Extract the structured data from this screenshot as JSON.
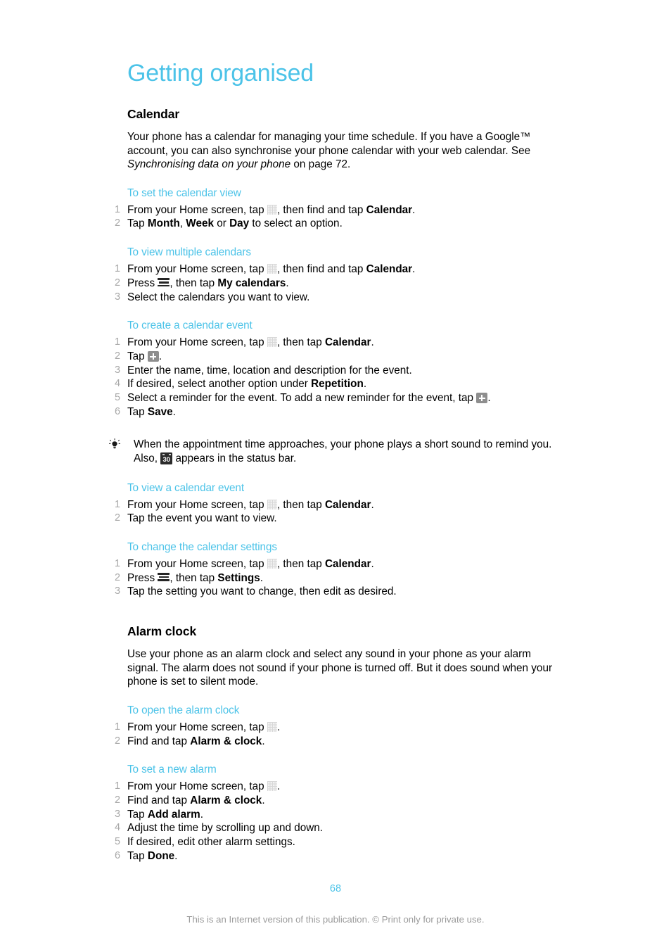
{
  "document": {
    "chapter_title": "Getting organised",
    "page_number": "68",
    "footer_note": "This is an Internet version of this publication. © Print only for private use.",
    "accent_color": "#4cc3e8",
    "step_number_color": "#a8a8a8",
    "footer_color": "#9b9b9b"
  },
  "sections": [
    {
      "heading": "Calendar",
      "intro_parts": {
        "p1": "Your phone has a calendar for managing your time schedule. If you have a Google™ account, you can also synchronise your phone calendar with your web calendar. See ",
        "italic": "Synchronising data on your phone",
        "p2": " on page 72."
      }
    },
    {
      "heading": "Alarm clock",
      "intro": "Use your phone as an alarm clock and select any sound in your phone as your alarm signal. The alarm does not sound if your phone is turned off. But it does sound when your phone is set to silent mode."
    }
  ],
  "procedures": {
    "set_calendar_view": {
      "title": "To set the calendar view",
      "steps": {
        "s1": {
          "num": "1",
          "a": "From your Home screen, tap ",
          "b": ", then find and tap ",
          "bold": "Calendar",
          "c": "."
        },
        "s2": {
          "num": "2",
          "a": "Tap ",
          "bold1": "Month",
          "b": ", ",
          "bold2": "Week",
          "c": " or ",
          "bold3": "Day",
          "d": " to select an option."
        }
      }
    },
    "view_multiple_calendars": {
      "title": "To view multiple calendars",
      "steps": {
        "s1": {
          "num": "1",
          "a": "From your Home screen, tap ",
          "b": ", then find and tap ",
          "bold": "Calendar",
          "c": "."
        },
        "s2": {
          "num": "2",
          "a": "Press ",
          "b": ", then tap ",
          "bold": "My calendars",
          "c": "."
        },
        "s3": {
          "num": "3",
          "a": "Select the calendars you want to view."
        }
      }
    },
    "create_calendar_event": {
      "title": "To create a calendar event",
      "steps": {
        "s1": {
          "num": "1",
          "a": "From your Home screen, tap ",
          "b": ", then tap ",
          "bold": "Calendar",
          "c": "."
        },
        "s2": {
          "num": "2",
          "a": "Tap ",
          "c": "."
        },
        "s3": {
          "num": "3",
          "a": "Enter the name, time, location and description for the event."
        },
        "s4": {
          "num": "4",
          "a": "If desired, select another option under ",
          "bold": "Repetition",
          "c": "."
        },
        "s5": {
          "num": "5",
          "a": "Select a reminder for the event. To add a new reminder for the event, tap ",
          "c": "."
        },
        "s6": {
          "num": "6",
          "a": "Tap ",
          "bold": "Save",
          "c": "."
        }
      }
    },
    "tip_calendar": {
      "a": "When the appointment time approaches, your phone plays a short sound to remind you. Also, ",
      "b": " appears in the status bar.",
      "icon_label": "30"
    },
    "view_calendar_event": {
      "title": "To view a calendar event",
      "steps": {
        "s1": {
          "num": "1",
          "a": "From your Home screen, tap ",
          "b": ", then tap ",
          "bold": "Calendar",
          "c": "."
        },
        "s2": {
          "num": "2",
          "a": "Tap the event you want to view."
        }
      }
    },
    "change_calendar_settings": {
      "title": "To change the calendar settings",
      "steps": {
        "s1": {
          "num": "1",
          "a": "From your Home screen, tap ",
          "b": ", then tap ",
          "bold": "Calendar",
          "c": "."
        },
        "s2": {
          "num": "2",
          "a": "Press ",
          "b": ", then tap ",
          "bold": "Settings",
          "c": "."
        },
        "s3": {
          "num": "3",
          "a": "Tap the setting you want to change, then edit as desired."
        }
      }
    },
    "open_alarm_clock": {
      "title": "To open the alarm clock",
      "steps": {
        "s1": {
          "num": "1",
          "a": "From your Home screen, tap ",
          "c": "."
        },
        "s2": {
          "num": "2",
          "a": "Find and tap ",
          "bold": "Alarm & clock",
          "c": "."
        }
      }
    },
    "set_new_alarm": {
      "title": "To set a new alarm",
      "steps": {
        "s1": {
          "num": "1",
          "a": "From your Home screen, tap ",
          "c": "."
        },
        "s2": {
          "num": "2",
          "a": "Find and tap ",
          "bold": "Alarm & clock",
          "c": "."
        },
        "s3": {
          "num": "3",
          "a": "Tap ",
          "bold": "Add alarm",
          "c": "."
        },
        "s4": {
          "num": "4",
          "a": "Adjust the time by scrolling up and down."
        },
        "s5": {
          "num": "5",
          "a": "If desired, edit other alarm settings."
        },
        "s6": {
          "num": "6",
          "a": "Tap ",
          "bold": "Done",
          "c": "."
        }
      }
    }
  }
}
